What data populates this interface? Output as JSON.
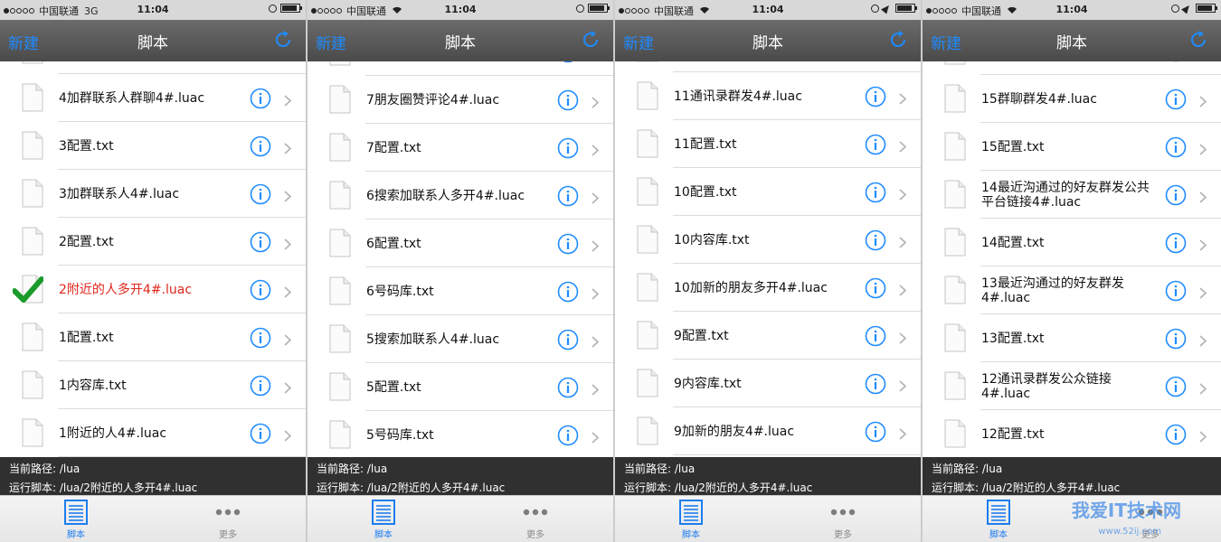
{
  "accent_color": "#1e8bff",
  "running_color": "#e0271d",
  "phones": [
    {
      "status": {
        "carrier": "中国联通",
        "network": "3G",
        "time": "11:04"
      },
      "nav": {
        "left": "新建",
        "title": "脚本"
      },
      "rows": [
        {
          "name": "4加群联系人群聊4#.luac",
          "running": false
        },
        {
          "name": "3配置.txt",
          "running": false
        },
        {
          "name": "3加群联系人4#.luac",
          "running": false
        },
        {
          "name": "2配置.txt",
          "running": false
        },
        {
          "name": "2附近的人多开4#.luac",
          "running": true
        },
        {
          "name": "1配置.txt",
          "running": false
        },
        {
          "name": "1内容库.txt",
          "running": false
        },
        {
          "name": "1附近的人4#.luac",
          "running": false
        }
      ],
      "footer": {
        "path": "当前路径: /lua",
        "running_script": "运行脚本: /lua/2附近的人多开4#.luac"
      },
      "tabs": [
        "脚本",
        "更多"
      ]
    },
    {
      "status": {
        "carrier": "中国联通",
        "network": "wifi",
        "time": "11:04"
      },
      "nav": {
        "left": "新建",
        "title": "脚本"
      },
      "rows": [
        {
          "name": "7朋友圈赞评论4#.luac",
          "running": false
        },
        {
          "name": "7配置.txt",
          "running": false
        },
        {
          "name": "6搜索加联系人多开4#.luac",
          "running": false
        },
        {
          "name": "6配置.txt",
          "running": false
        },
        {
          "name": "6号码库.txt",
          "running": false
        },
        {
          "name": "5搜索加联系人4#.luac",
          "running": false
        },
        {
          "name": "5配置.txt",
          "running": false
        },
        {
          "name": "5号码库.txt",
          "running": false
        }
      ],
      "footer": {
        "path": "当前路径: /lua",
        "running_script": "运行脚本: /lua/2附近的人多开4#.luac"
      },
      "tabs": [
        "脚本",
        "更多"
      ]
    },
    {
      "status": {
        "carrier": "中国联通",
        "network": "wifi",
        "time": "11:04"
      },
      "nav": {
        "left": "新建",
        "title": "脚本"
      },
      "rows": [
        {
          "name": "11通讯录群发4#.luac",
          "running": false
        },
        {
          "name": "11配置.txt",
          "running": false
        },
        {
          "name": "10配置.txt",
          "running": false
        },
        {
          "name": "10内容库.txt",
          "running": false
        },
        {
          "name": "10加新的朋友多开4#.luac",
          "running": false
        },
        {
          "name": "9配置.txt",
          "running": false
        },
        {
          "name": "9内容库.txt",
          "running": false
        },
        {
          "name": "9加新的朋友4#.luac",
          "running": false
        }
      ],
      "footer": {
        "path": "当前路径: /lua",
        "running_script": "运行脚本: /lua/2附近的人多开4#.luac"
      },
      "tabs": [
        "脚本",
        "更多"
      ]
    },
    {
      "status": {
        "carrier": "中国联通",
        "network": "wifi",
        "time": "11:04"
      },
      "nav": {
        "left": "新建",
        "title": "脚本"
      },
      "rows": [
        {
          "name": "15群聊群发4#.luac",
          "running": false
        },
        {
          "name": "15配置.txt",
          "running": false
        },
        {
          "name": "14最近沟通过的好友群发公共平台链接4#.luac",
          "running": false
        },
        {
          "name": "14配置.txt",
          "running": false
        },
        {
          "name": "13最近沟通过的好友群发4#.luac",
          "running": false
        },
        {
          "name": "13配置.txt",
          "running": false
        },
        {
          "name": "12通讯录群发公众链接4#.luac",
          "running": false
        },
        {
          "name": "12配置.txt",
          "running": false
        }
      ],
      "footer": {
        "path": "当前路径: /lua",
        "running_script": "运行脚本: /lua/2附近的人多开4#.luac"
      },
      "tabs": [
        "脚本",
        "更多"
      ]
    }
  ],
  "watermark": {
    "text": "我爱IT技术网",
    "sub": "www.52ij.com"
  }
}
